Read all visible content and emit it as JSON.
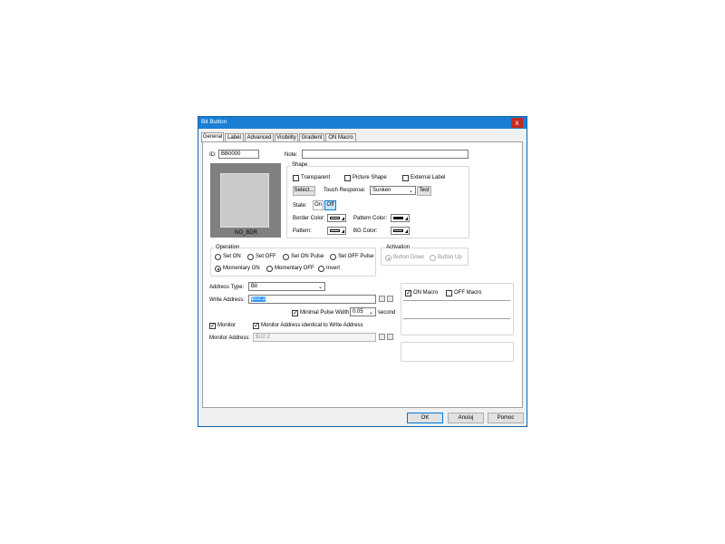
{
  "window": {
    "title": "Bit Button",
    "close_glyph": "x"
  },
  "tabs": [
    "General",
    "Label",
    "Advanced",
    "Visibility",
    "Gradient",
    "ON Macro"
  ],
  "general": {
    "id_label": "ID:",
    "id_value": "BB0000",
    "note_label": "Note:",
    "note_value": "",
    "preview_caption": "NO_BDR",
    "shape": {
      "title": "Shape",
      "transparent": "Transparent",
      "picture_shape": "Picture Shape",
      "external_label": "External Label",
      "select_btn": "Select...",
      "touch_response_label": "Touch Response:",
      "touch_response_value": "Sunken",
      "test_btn": "Test",
      "state_label": "State:",
      "state_on": "On",
      "state_off": "Off",
      "border_color_label": "Border Color:",
      "pattern_color_label": "Pattern Color:",
      "pattern_label": "Pattern:",
      "bg_color_label": "BG Color:"
    },
    "operation": {
      "title": "Operation",
      "options": [
        "Set ON",
        "Set OFF",
        "Set ON Pulse",
        "Set OFF Pulse",
        "Momentary ON",
        "Momentary OFF",
        "Invert"
      ],
      "selected": "Momentary ON"
    },
    "activation": {
      "title": "Activation",
      "options": [
        "Button Down",
        "Button Up"
      ]
    },
    "address_type_label": "Address Type:",
    "address_type_value": "Bit",
    "write_address_label": "Write Address:",
    "write_address_value": "$U2.2",
    "minimal_pulse_label": "Minimal Pulse Width",
    "minimal_pulse_value": "0.05",
    "second_label": "second",
    "monitor_label": "Monitor",
    "monitor_identical_label": "Monitor Address identical to Write Address",
    "monitor_address_label": "Monitor Address:",
    "monitor_address_value": "$U2.2",
    "on_macro": "ON Macro",
    "off_macro": "OFF Macro"
  },
  "footer": {
    "ok": "OK",
    "cancel": "Anuluj",
    "help": "Pomoc"
  }
}
